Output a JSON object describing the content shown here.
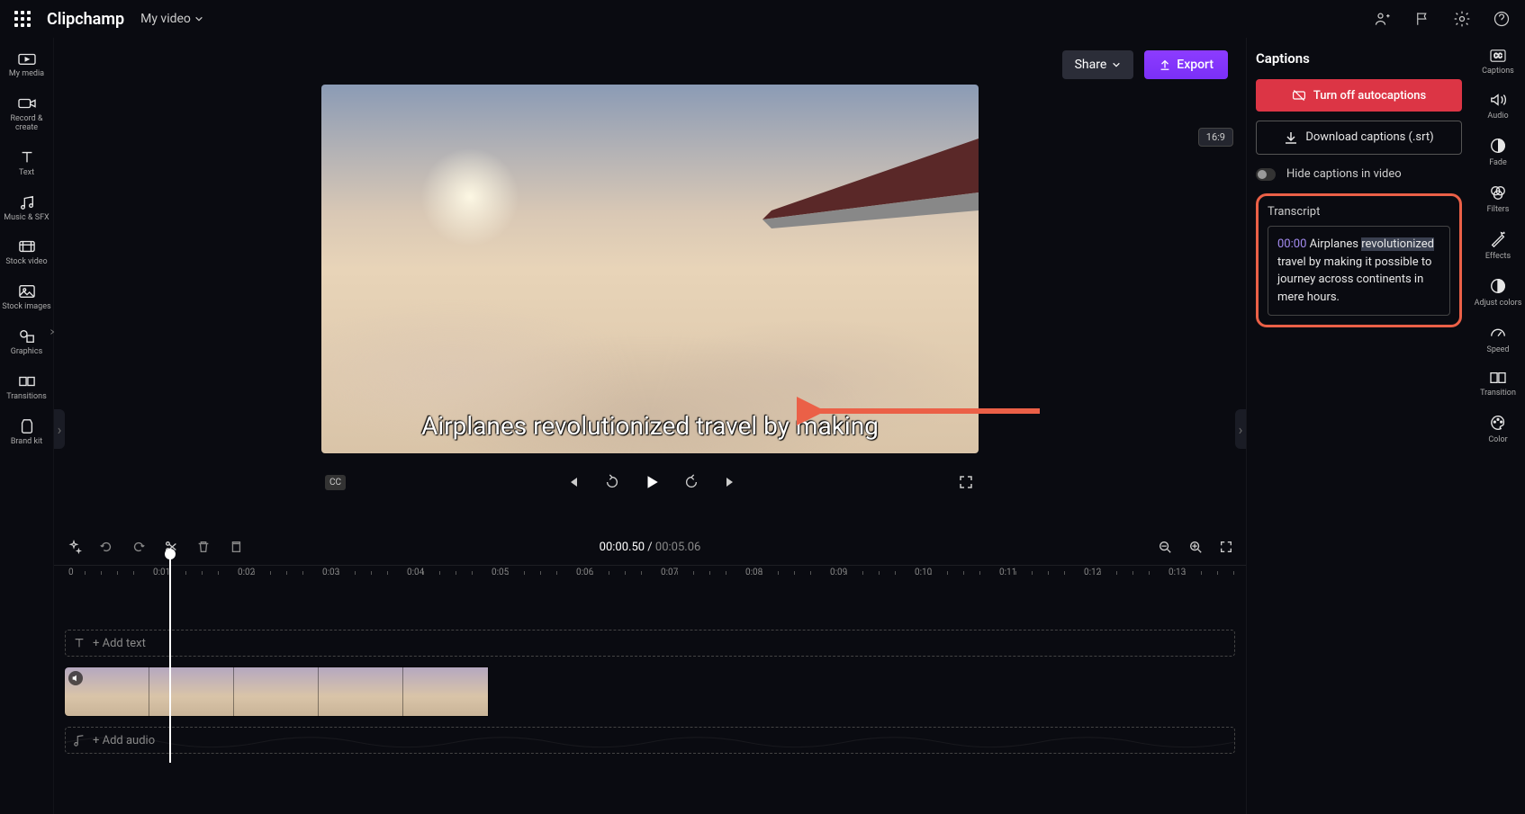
{
  "app": {
    "brand": "Clipchamp",
    "project_name": "My video"
  },
  "top_icons": [
    "people",
    "flag",
    "settings",
    "help"
  ],
  "left_sidebar": [
    {
      "id": "my-media",
      "label": "My media"
    },
    {
      "id": "record",
      "label": "Record & create"
    },
    {
      "id": "text",
      "label": "Text"
    },
    {
      "id": "music",
      "label": "Music & SFX"
    },
    {
      "id": "stock-video",
      "label": "Stock video"
    },
    {
      "id": "stock-images",
      "label": "Stock images"
    },
    {
      "id": "graphics",
      "label": "Graphics"
    },
    {
      "id": "transitions",
      "label": "Transitions"
    },
    {
      "id": "brand-kit",
      "label": "Brand kit"
    }
  ],
  "right_sidebar": [
    {
      "id": "captions",
      "label": "Captions"
    },
    {
      "id": "audio",
      "label": "Audio"
    },
    {
      "id": "fade",
      "label": "Fade"
    },
    {
      "id": "filters",
      "label": "Filters"
    },
    {
      "id": "effects",
      "label": "Effects"
    },
    {
      "id": "adjust-colors",
      "label": "Adjust colors"
    },
    {
      "id": "speed",
      "label": "Speed"
    },
    {
      "id": "transition",
      "label": "Transition"
    },
    {
      "id": "color",
      "label": "Color"
    }
  ],
  "actions": {
    "share": "Share",
    "export": "Export"
  },
  "preview": {
    "aspect": "16:9",
    "caption_text": "Airplanes revolutionized travel by making",
    "cc_badge": "CC"
  },
  "captions_panel": {
    "title": "Captions",
    "turn_off": "Turn off autocaptions",
    "download": "Download captions (.srt)",
    "hide": "Hide captions in video",
    "transcript_title": "Transcript",
    "transcript_time": "00:00",
    "transcript_pre": "Airplanes ",
    "transcript_hl": "revolutionized",
    "transcript_post": " travel by making it possible to journey across continents in mere hours."
  },
  "timeline": {
    "current": "00:00.50",
    "total": "00:05.06",
    "marks": [
      "0",
      "0:01",
      "0:02",
      "0:03",
      "0:04",
      "0:05",
      "0:06",
      "0:07",
      "0:08",
      "0:09",
      "0:10",
      "0:11",
      "0:12",
      "0:13"
    ],
    "text_track": "+ Add text",
    "audio_track": "+ Add audio"
  }
}
